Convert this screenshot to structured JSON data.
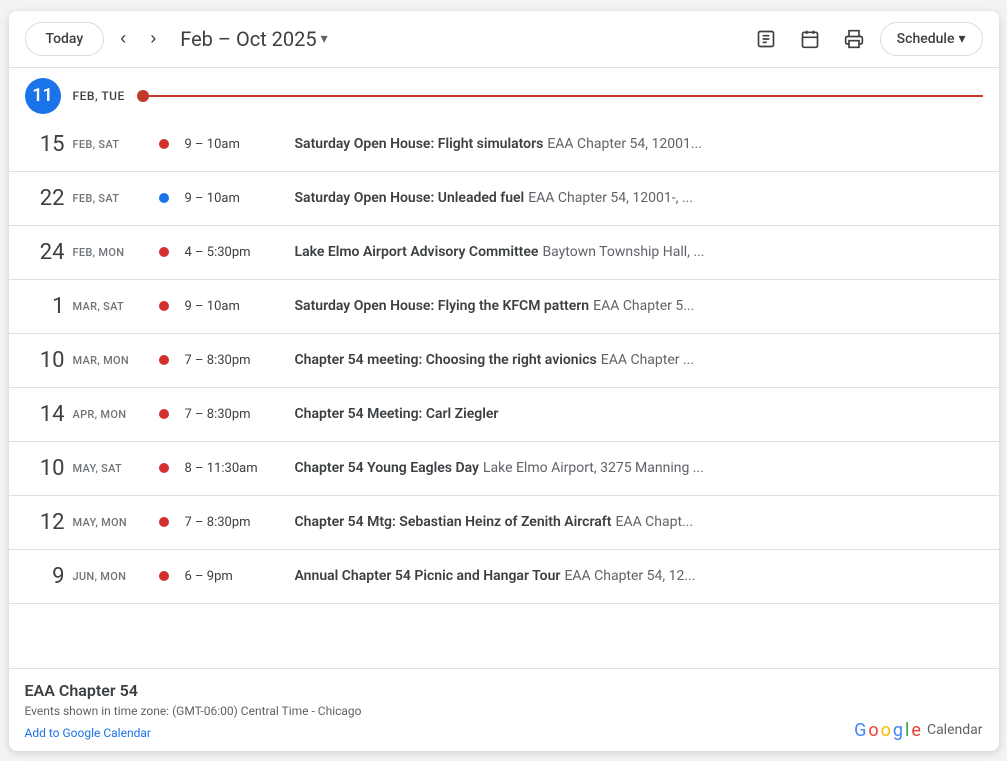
{
  "header": {
    "today_label": "Today",
    "date_range": "Feb – Oct 2025",
    "schedule_label": "Schedule"
  },
  "today": {
    "day_num": "11",
    "day_label": "FEB, TUE"
  },
  "events": [
    {
      "day_num": "15",
      "day_label": "FEB, SAT",
      "dot_color": "red",
      "time": "9 – 10am",
      "title": "Saturday Open House: Flight simulators",
      "location": "EAA Chapter 54, 12001..."
    },
    {
      "day_num": "22",
      "day_label": "FEB, SAT",
      "dot_color": "blue",
      "time": "9 – 10am",
      "title": "Saturday Open House: Unleaded fuel",
      "location": "EAA Chapter 54, 12001-, ..."
    },
    {
      "day_num": "24",
      "day_label": "FEB, MON",
      "dot_color": "red",
      "time": "4 – 5:30pm",
      "title": "Lake Elmo Airport Advisory Committee",
      "location": "Baytown Township Hall, ..."
    },
    {
      "day_num": "1",
      "day_label": "MAR, SAT",
      "dot_color": "red",
      "time": "9 – 10am",
      "title": "Saturday Open House: Flying the KFCM pattern",
      "location": "EAA Chapter 5..."
    },
    {
      "day_num": "10",
      "day_label": "MAR, MON",
      "dot_color": "red",
      "time": "7 – 8:30pm",
      "title": "Chapter 54 meeting: Choosing the right avionics",
      "location": "EAA Chapter ..."
    },
    {
      "day_num": "14",
      "day_label": "APR, MON",
      "dot_color": "red",
      "time": "7 – 8:30pm",
      "title": "Chapter 54 Meeting: Carl Ziegler",
      "location": ""
    },
    {
      "day_num": "10",
      "day_label": "MAY, SAT",
      "dot_color": "red",
      "time": "8 – 11:30am",
      "title": "Chapter 54 Young Eagles Day",
      "location": "Lake Elmo Airport, 3275 Manning ..."
    },
    {
      "day_num": "12",
      "day_label": "MAY, MON",
      "dot_color": "red",
      "time": "7 – 8:30pm",
      "title": "Chapter 54 Mtg: Sebastian Heinz of Zenith Aircraft",
      "location": "EAA Chapt..."
    },
    {
      "day_num": "9",
      "day_label": "JUN, MON",
      "dot_color": "red",
      "time": "6 – 9pm",
      "title": "Annual Chapter 54 Picnic and Hangar Tour",
      "location": "EAA Chapter 54, 12..."
    }
  ],
  "footer": {
    "org_name": "EAA Chapter 54",
    "timezone_note": "Events shown in time zone: (GMT-06:00) Central Time - Chicago",
    "add_link": "Add to Google Calendar",
    "google_text": "Google",
    "calendar_text": "Calendar"
  }
}
